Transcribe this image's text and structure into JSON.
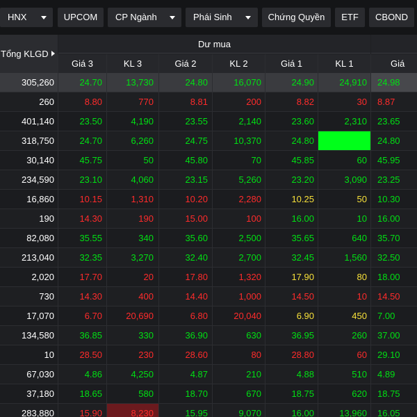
{
  "tabs": [
    {
      "label": "HNX",
      "dropdown": true
    },
    {
      "label": "UPCOM",
      "dropdown": false
    },
    {
      "label": "CP Ngành",
      "dropdown": true
    },
    {
      "label": "Phái Sinh",
      "dropdown": true
    },
    {
      "label": "Chứng Quyền",
      "dropdown": false
    },
    {
      "label": "ETF",
      "dropdown": false
    },
    {
      "label": "CBOND",
      "dropdown": false
    }
  ],
  "header": {
    "total_volume_label": "Tổng KLGD",
    "group_title": "Dư mua",
    "columns": [
      "Giá 3",
      "KL 3",
      "Giá 2",
      "KL 2",
      "Giá 1",
      "KL 1",
      "Giá"
    ]
  },
  "colors": {
    "up": "#00e013",
    "down": "#ff2b2b",
    "reference": "#f7e03a",
    "flash": "#00ff1a"
  },
  "rows": [
    {
      "total": "305,260",
      "g3": "24.70",
      "kl3": "13,730",
      "g2": "24.80",
      "kl2": "16,070",
      "g1": "24.90",
      "kl1": "24,910",
      "g": "24.98",
      "c3": "up",
      "c2": "up",
      "c1": "up",
      "c0": "up",
      "highlight": true
    },
    {
      "total": "260",
      "g3": "8.80",
      "kl3": "770",
      "g2": "8.81",
      "kl2": "200",
      "g1": "8.82",
      "kl1": "30",
      "g": "8.87",
      "c3": "down",
      "c2": "down",
      "c1": "down",
      "c0": "down"
    },
    {
      "total": "401,140",
      "g3": "23.50",
      "kl3": "4,190",
      "g2": "23.55",
      "kl2": "2,140",
      "g1": "23.60",
      "kl1": "2,310",
      "g": "23.65",
      "c3": "up",
      "c2": "up",
      "c1": "up",
      "c0": "up"
    },
    {
      "total": "318,750",
      "g3": "24.70",
      "kl3": "6,260",
      "g2": "24.75",
      "kl2": "10,370",
      "g1": "24.80",
      "kl1": "",
      "g": "24.80",
      "c3": "up",
      "c2": "up",
      "c1": "up",
      "c0": "up",
      "flash_kl1": true
    },
    {
      "total": "30,140",
      "g3": "45.75",
      "kl3": "50",
      "g2": "45.80",
      "kl2": "70",
      "g1": "45.85",
      "kl1": "60",
      "g": "45.95",
      "c3": "up",
      "c2": "up",
      "c1": "up",
      "c0": "up"
    },
    {
      "total": "234,590",
      "g3": "23.10",
      "kl3": "4,060",
      "g2": "23.15",
      "kl2": "5,260",
      "g1": "23.20",
      "kl1": "3,090",
      "g": "23.25",
      "c3": "up",
      "c2": "up",
      "c1": "up",
      "c0": "up"
    },
    {
      "total": "16,860",
      "g3": "10.15",
      "kl3": "1,310",
      "g2": "10.20",
      "kl2": "2,280",
      "g1": "10.25",
      "kl1": "50",
      "g": "10.30",
      "c3": "down",
      "c2": "down",
      "c1": "ref",
      "c0": "up"
    },
    {
      "total": "190",
      "g3": "14.30",
      "kl3": "190",
      "g2": "15.00",
      "kl2": "100",
      "g1": "16.00",
      "kl1": "10",
      "g": "16.00",
      "c3": "down",
      "c2": "down",
      "c1": "up",
      "c0": "up"
    },
    {
      "total": "82,080",
      "g3": "35.55",
      "kl3": "340",
      "g2": "35.60",
      "kl2": "2,500",
      "g1": "35.65",
      "kl1": "640",
      "g": "35.70",
      "c3": "up",
      "c2": "up",
      "c1": "up",
      "c0": "up"
    },
    {
      "total": "213,040",
      "g3": "32.35",
      "kl3": "3,270",
      "g2": "32.40",
      "kl2": "2,700",
      "g1": "32.45",
      "kl1": "1,560",
      "g": "32.50",
      "c3": "up",
      "c2": "up",
      "c1": "up",
      "c0": "up"
    },
    {
      "total": "2,020",
      "g3": "17.70",
      "kl3": "20",
      "g2": "17.80",
      "kl2": "1,320",
      "g1": "17.90",
      "kl1": "80",
      "g": "18.00",
      "c3": "down",
      "c2": "down",
      "c1": "ref",
      "c0": "up"
    },
    {
      "total": "730",
      "g3": "14.30",
      "kl3": "400",
      "g2": "14.40",
      "kl2": "1,000",
      "g1": "14.50",
      "kl1": "10",
      "g": "14.50",
      "c3": "down",
      "c2": "down",
      "c1": "down",
      "c0": "down"
    },
    {
      "total": "17,070",
      "g3": "6.70",
      "kl3": "20,690",
      "g2": "6.80",
      "kl2": "20,040",
      "g1": "6.90",
      "kl1": "450",
      "g": "7.00",
      "c3": "down",
      "c2": "down",
      "c1": "ref",
      "c0": "up"
    },
    {
      "total": "134,580",
      "g3": "36.85",
      "kl3": "330",
      "g2": "36.90",
      "kl2": "630",
      "g1": "36.95",
      "kl1": "260",
      "g": "37.00",
      "c3": "up",
      "c2": "up",
      "c1": "up",
      "c0": "up"
    },
    {
      "total": "10",
      "g3": "28.50",
      "kl3": "230",
      "g2": "28.60",
      "kl2": "80",
      "g1": "28.80",
      "kl1": "60",
      "g": "29.10",
      "c3": "down",
      "c2": "down",
      "c1": "down",
      "c0": "up"
    },
    {
      "total": "67,030",
      "g3": "4.86",
      "kl3": "4,250",
      "g2": "4.87",
      "kl2": "210",
      "g1": "4.88",
      "kl1": "510",
      "g": "4.89",
      "c3": "up",
      "c2": "up",
      "c1": "up",
      "c0": "up"
    },
    {
      "total": "37,180",
      "g3": "18.65",
      "kl3": "580",
      "g2": "18.70",
      "kl2": "670",
      "g1": "18.75",
      "kl1": "620",
      "g": "18.75",
      "c3": "up",
      "c2": "up",
      "c1": "up",
      "c0": "up"
    },
    {
      "total": "283,880",
      "g3": "15.90",
      "kl3": "8,230",
      "g2": "15.95",
      "kl2": "9,070",
      "g1": "16.00",
      "kl1": "13,960",
      "g": "16.05",
      "c3": "down",
      "c2": "up",
      "c1": "up",
      "c0": "up",
      "flash_kl3": true
    }
  ]
}
